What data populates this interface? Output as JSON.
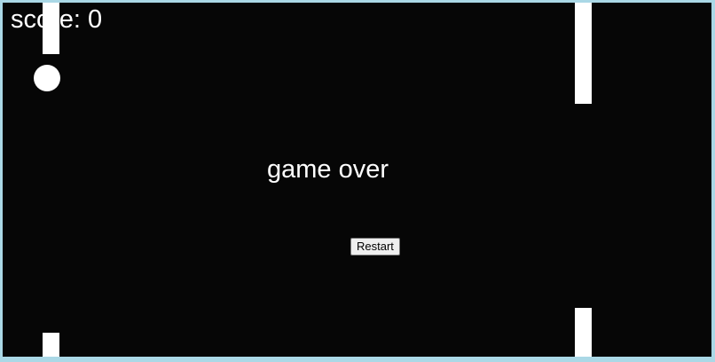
{
  "game": {
    "score_label": "score: 0",
    "game_over_text": "game over",
    "restart_label": "Restart",
    "score": 0
  },
  "colors": {
    "background": "#060606",
    "frame_border": "#aad8e6",
    "foreground": "#ffffff"
  }
}
